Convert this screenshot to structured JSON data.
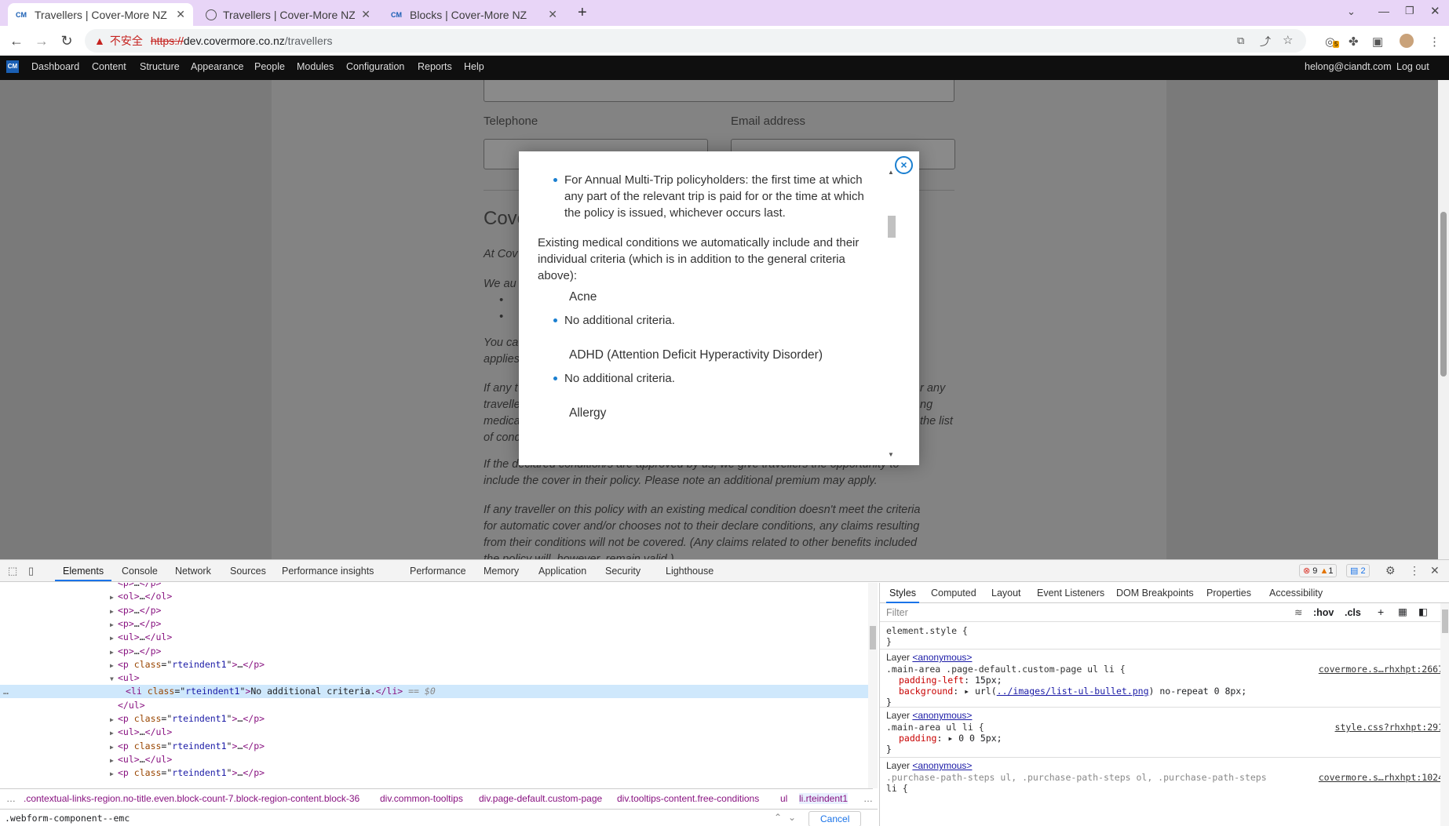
{
  "browser": {
    "tabs": [
      {
        "title": "Travellers | Cover-More NZ",
        "favicon": "CM"
      },
      {
        "title": "Travellers | Cover-More NZ",
        "favicon": "globe"
      },
      {
        "title": "Blocks | Cover-More NZ",
        "favicon": "CM"
      }
    ],
    "new_tab": "+",
    "security_warning": "不安全",
    "url_scheme": "https://",
    "url_host": "dev.covermore.co.nz",
    "url_path": "/travellers",
    "notification_count": "5"
  },
  "adminbar": {
    "logo": "CM",
    "menu": [
      "Dashboard",
      "Content",
      "Structure",
      "Appearance",
      "People",
      "Modules",
      "Configuration",
      "Reports",
      "Help"
    ],
    "user": "helong@ciandt.com",
    "logout": "Log out"
  },
  "page": {
    "telephone_label": "Telephone",
    "email_label": "Email address",
    "heading_partial": "Cove",
    "para1_partial": "At Cov",
    "para2_partial": "We au",
    "para3_partial": [
      "You ca",
      "applies"
    ],
    "para4_left": [
      "If any t",
      "travelle",
      "medica",
      "of cond"
    ],
    "para4_right": [
      "r any",
      "ng",
      "the list"
    ],
    "para5": [
      "If the declared condition/s are approved by us, we give travellers the opportunity to",
      "include the cover in their policy. Please note an additional premium may apply."
    ],
    "para6": [
      "If any traveller on this policy with an existing medical condition doesn't meet the criteria",
      "for automatic cover and/or chooses not to their declare conditions, any claims resulting",
      "from their conditions will not be covered. (Any claims related to other benefits included",
      "the policy will, however, remain valid.)"
    ]
  },
  "modal": {
    "close": "×",
    "bullet_intro": "For Annual Multi-Trip policyholders: the first time at which any part of the relevant trip is paid for or the time at which the policy is issued, whichever occurs last.",
    "section_intro": "Existing medical conditions we automatically include and their individual criteria (which is in addition to the general criteria above):",
    "conditions": [
      {
        "name": "Acne",
        "criteria": "No additional criteria."
      },
      {
        "name": "ADHD (Attention Deficit Hyperactivity Disorder)",
        "criteria": "No additional criteria."
      },
      {
        "name": "Allergy",
        "criteria": ""
      }
    ]
  },
  "devtools": {
    "tabs": [
      "Elements",
      "Console",
      "Network",
      "Sources",
      "Performance insights",
      "Performance",
      "Memory",
      "Application",
      "Security",
      "Lighthouse"
    ],
    "errors": "9",
    "warnings": "1",
    "messages": "2",
    "dom_lines": [
      {
        "indent": 1,
        "tri": "",
        "open": "<p>",
        "mid": "…",
        "close": "</p>"
      },
      {
        "indent": 1,
        "tri": "▶",
        "open": "<ol>",
        "mid": "…",
        "close": "</ol>"
      },
      {
        "indent": 1,
        "tri": "▶",
        "open": "<p>",
        "mid": "…",
        "close": "</p>"
      },
      {
        "indent": 1,
        "tri": "▶",
        "open": "<p>",
        "mid": "…",
        "close": "</p>"
      },
      {
        "indent": 1,
        "tri": "▶",
        "open": "<ul>",
        "mid": "…",
        "close": "</ul>"
      },
      {
        "indent": 1,
        "tri": "▶",
        "open": "<p>",
        "mid": "…",
        "close": "</p>"
      },
      {
        "indent": 1,
        "tri": "▶",
        "open": "<p class=\"rteindent1\">",
        "mid": "…",
        "close": "</p>"
      },
      {
        "indent": 1,
        "tri": "▼",
        "open": "<ul>",
        "mid": "",
        "close": ""
      },
      {
        "indent": 2,
        "tri": "",
        "open": "<li class=\"rteindent1\">",
        "mid": "No additional criteria.",
        "close": "</li>",
        "selected": true,
        "suffix": "== $0"
      },
      {
        "indent": 1,
        "tri": "",
        "open": "</ul>",
        "mid": "",
        "close": ""
      },
      {
        "indent": 1,
        "tri": "▶",
        "open": "<p class=\"rteindent1\">",
        "mid": "…",
        "close": "</p>"
      },
      {
        "indent": 1,
        "tri": "▶",
        "open": "<ul>",
        "mid": "…",
        "close": "</ul>"
      },
      {
        "indent": 1,
        "tri": "▶",
        "open": "<p class=\"rteindent1\">",
        "mid": "…",
        "close": "</p>"
      },
      {
        "indent": 1,
        "tri": "▶",
        "open": "<ul>",
        "mid": "…",
        "close": "</ul>"
      },
      {
        "indent": 1,
        "tri": "▶",
        "open": "<p class=\"rteindent1\">",
        "mid": "…",
        "close": "</p>"
      }
    ],
    "breadcrumbs": [
      ".contextual-links-region.no-title.even.block-count-7.block-region-content.block-36",
      "div.common-tooltips",
      "div.page-default.custom-page",
      "div.tooltips-content.free-conditions",
      "ul",
      "li.rteindent1"
    ],
    "search_value": ".webform-component--emc",
    "cancel": "Cancel",
    "style_tabs": [
      "Styles",
      "Computed",
      "Layout",
      "Event Listeners",
      "DOM Breakpoints",
      "Properties",
      "Accessibility"
    ],
    "filter_placeholder": "Filter",
    "hov": ":hov",
    "cls": ".cls",
    "element_style": "element.style {",
    "close_brace": "}",
    "layer_label": "Layer",
    "layer_anon": "<anonymous>",
    "rule1": {
      "selector": ".main-area .page-default.custom-page ul li {",
      "source": "covermore.s…rhxhpt:2667",
      "p1": "padding-left",
      "v1": "15px;",
      "p2": "background",
      "v2a": "url(",
      "v2link": "../images/list-ul-bullet.png",
      "v2b": ") no-repeat 0 8px;"
    },
    "rule2": {
      "selector": ".main-area ul li {",
      "source": "style.css?rhxhpt:291",
      "p1": "padding",
      "v1": "0 0 5px;"
    },
    "rule3": {
      "selector": ".purchase-path-steps ul, .purchase-path-steps ol, .purchase-path-steps",
      "selector2": "li {",
      "source": "covermore.s…rhxhpt:1024"
    }
  }
}
